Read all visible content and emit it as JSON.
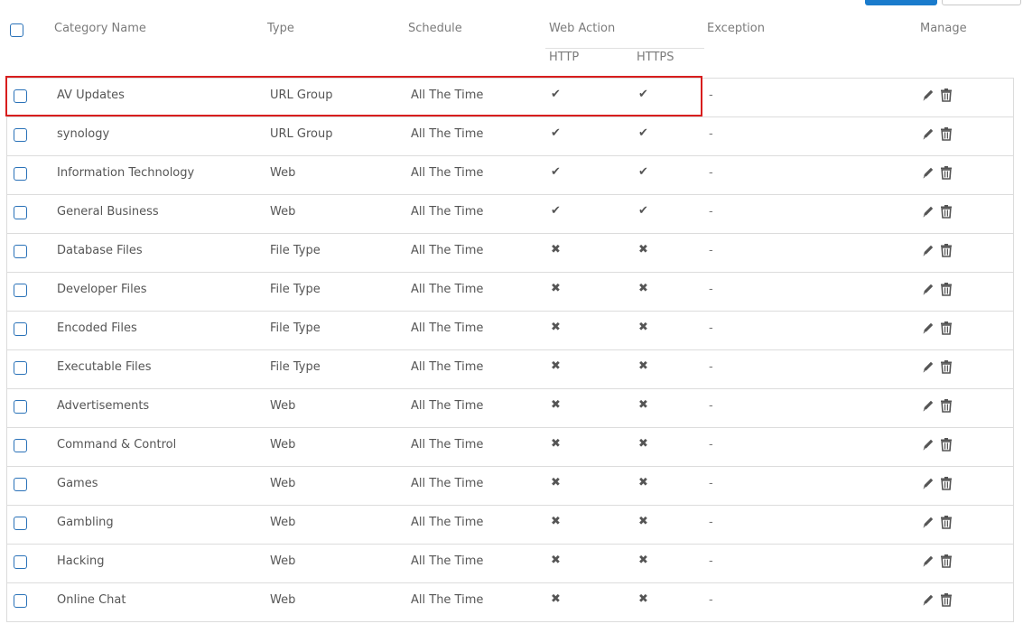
{
  "header": {
    "category_name": "Category Name",
    "type": "Type",
    "schedule": "Schedule",
    "web_action": "Web Action",
    "http": "HTTP",
    "https": "HTTPS",
    "exception": "Exception",
    "manage": "Manage"
  },
  "rows": [
    {
      "name": "AV Updates",
      "type": "URL Group",
      "schedule": "All The Time",
      "http": "✔",
      "https": "✔",
      "exception": "-"
    },
    {
      "name": "synology",
      "type": "URL Group",
      "schedule": "All The Time",
      "http": "✔",
      "https": "✔",
      "exception": "-"
    },
    {
      "name": "Information Technology",
      "type": "Web",
      "schedule": "All The Time",
      "http": "✔",
      "https": "✔",
      "exception": "-"
    },
    {
      "name": "General Business",
      "type": "Web",
      "schedule": "All The Time",
      "http": "✔",
      "https": "✔",
      "exception": "-"
    },
    {
      "name": "Database Files",
      "type": "File Type",
      "schedule": "All The Time",
      "http": "✖",
      "https": "✖",
      "exception": "-"
    },
    {
      "name": "Developer Files",
      "type": "File Type",
      "schedule": "All The Time",
      "http": "✖",
      "https": "✖",
      "exception": "-"
    },
    {
      "name": "Encoded Files",
      "type": "File Type",
      "schedule": "All The Time",
      "http": "✖",
      "https": "✖",
      "exception": "-"
    },
    {
      "name": "Executable Files",
      "type": "File Type",
      "schedule": "All The Time",
      "http": "✖",
      "https": "✖",
      "exception": "-"
    },
    {
      "name": "Advertisements",
      "type": "Web",
      "schedule": "All The Time",
      "http": "✖",
      "https": "✖",
      "exception": "-"
    },
    {
      "name": "Command & Control",
      "type": "Web",
      "schedule": "All The Time",
      "http": "✖",
      "https": "✖",
      "exception": "-"
    },
    {
      "name": "Games",
      "type": "Web",
      "schedule": "All The Time",
      "http": "✖",
      "https": "✖",
      "exception": "-"
    },
    {
      "name": "Gambling",
      "type": "Web",
      "schedule": "All The Time",
      "http": "✖",
      "https": "✖",
      "exception": "-"
    },
    {
      "name": "Hacking",
      "type": "Web",
      "schedule": "All The Time",
      "http": "✖",
      "https": "✖",
      "exception": "-"
    },
    {
      "name": "Online Chat",
      "type": "Web",
      "schedule": "All The Time",
      "http": "✖",
      "https": "✖",
      "exception": "-"
    }
  ],
  "icons": {
    "edit": "pencil-icon",
    "delete": "trash-icon"
  },
  "colors": {
    "accent": "#1a7bcc",
    "checkbox_border": "#2a72b8",
    "highlight": "#d81e1e",
    "row_border": "#dcdcdc"
  }
}
